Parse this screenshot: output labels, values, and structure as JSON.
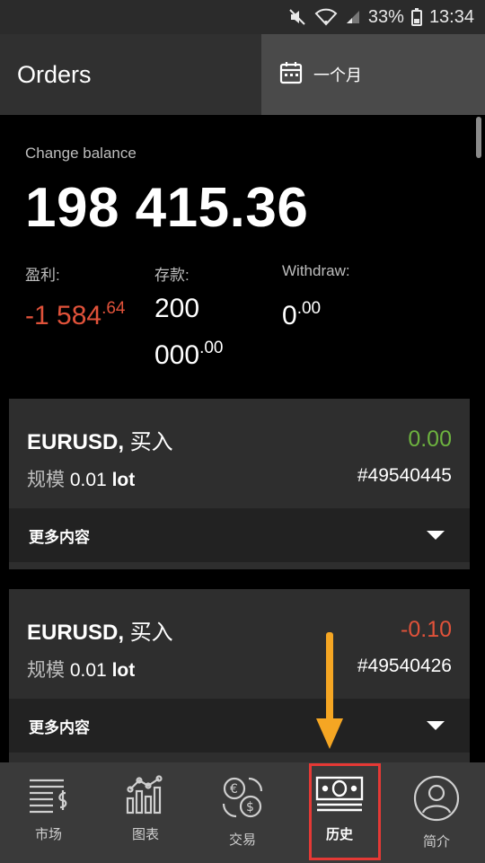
{
  "status_bar": {
    "battery": "33%",
    "time": "13:34"
  },
  "header": {
    "title": "Orders",
    "period": "一个月"
  },
  "balance": {
    "caption": "Change balance",
    "value": "198 415.36"
  },
  "stats": {
    "profit": {
      "label": "盈利:",
      "main": "-1 584",
      "frac": ".64"
    },
    "deposit": {
      "label": "存款:",
      "main_line1": "200",
      "main_line2": "000",
      "frac": ".00"
    },
    "withdraw": {
      "label": "Withdraw:",
      "main": "0",
      "frac": ".00"
    }
  },
  "orders": [
    {
      "symbol": "EURUSD,",
      "side": "买入",
      "profit": "0.00",
      "size_label": "规模",
      "size_value": "0.01",
      "size_unit": "lot",
      "ticket": "#49540445",
      "more_label": "更多内容"
    },
    {
      "symbol": "EURUSD,",
      "side": "买入",
      "profit": "-0.10",
      "size_label": "规模",
      "size_value": "0.01",
      "size_unit": "lot",
      "ticket": "#49540426",
      "more_label": "更多内容"
    }
  ],
  "nav": [
    {
      "label": "市场",
      "icon": "market-icon"
    },
    {
      "label": "图表",
      "icon": "chart-icon"
    },
    {
      "label": "交易",
      "icon": "exchange-icon"
    },
    {
      "label": "历史",
      "icon": "history-icon"
    },
    {
      "label": "简介",
      "icon": "profile-icon"
    }
  ],
  "colors": {
    "negative": "#e0523a",
    "positive": "#6db33f",
    "highlight": "#e53935",
    "arrow": "#f5a623"
  }
}
